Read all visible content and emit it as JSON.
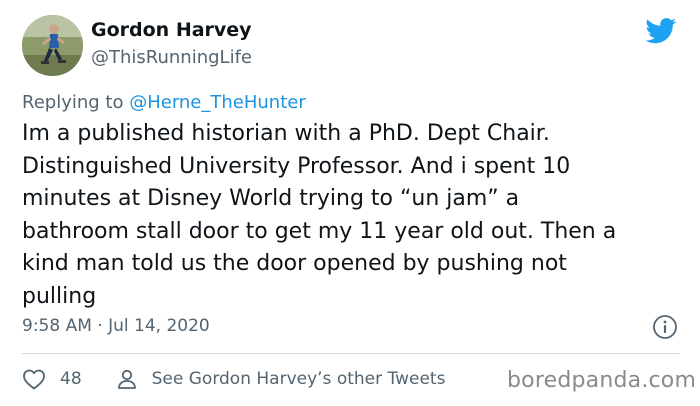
{
  "author": {
    "name": "Gordon Harvey",
    "handle": "@ThisRunningLife",
    "avatar_icon": "runner-avatar"
  },
  "platform_icon": "twitter-bird-icon",
  "reply": {
    "prefix": "Replying to ",
    "mention": "@Herne_TheHunter"
  },
  "tweet": {
    "lines": [
      "Im a published historian with a PhD. Dept Chair.",
      "Distinguished University Professor. And i spent 10",
      "minutes at Disney World trying to “un jam” a",
      "bathroom stall door to get my 11 year old out. Then a",
      "kind man told us the door opened by pushing not",
      "pulling"
    ],
    "timestamp": "9:58 AM · Jul 14, 2020"
  },
  "actions": {
    "like_count": "48",
    "other_tweets_label": "See Gordon Harvey’s other Tweets"
  },
  "watermark": "boredpanda.com",
  "colors": {
    "twitter_blue": "#1da1f2",
    "mention_blue": "#1b95e0",
    "secondary_text": "#536471",
    "primary_text": "#0f1419"
  }
}
